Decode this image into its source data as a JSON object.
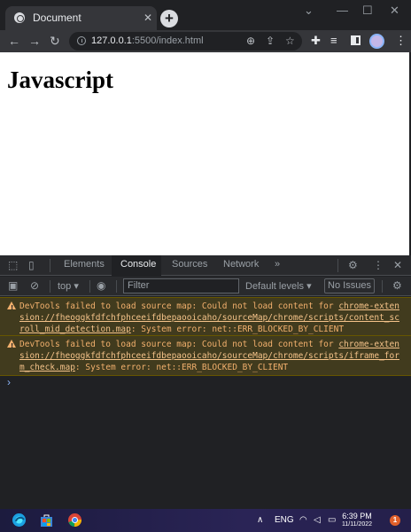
{
  "browser": {
    "tab_title": "Document",
    "tab_close": "✕",
    "new_tab": "+",
    "url_host": "127.0.0.1",
    "url_rest": ":5500/index.html",
    "icons": [
      "back-icon",
      "forward-icon",
      "reload-icon",
      "zoom-icon",
      "share-icon",
      "star-icon",
      "extensions-icon",
      "media-icon",
      "side-panel-icon",
      "profile-avatar",
      "menu-icon"
    ]
  },
  "page": {
    "heading": "Javascript"
  },
  "devtools": {
    "tabs": [
      "Elements",
      "Console",
      "Sources",
      "Network"
    ],
    "active_tab": "Console",
    "more_tabs": "»",
    "context": "top",
    "filter_placeholder": "Filter",
    "log_levels": "Default levels",
    "issues": "No Issues",
    "messages": [
      {
        "prefix": "DevTools failed to load source map: Could not load content for ",
        "link": "chrome-extension://fheoggkfdfchfphceeifdbepaooicaho/sourceMap/chrome/scripts/content_scroll_mid_detection.map",
        "suffix": ": System error: net::ERR_BLOCKED_BY_CLIENT"
      },
      {
        "prefix": "DevTools failed to load source map: Could not load content for ",
        "link": "chrome-extension://fheoggkfdfchfphceeifdbepaooicaho/sourceMap/chrome/scripts/iframe_form_check.map",
        "suffix": ": System error: net::ERR_BLOCKED_BY_CLIENT"
      }
    ],
    "prompt": "›",
    "warning_color": "#f2b06d"
  },
  "taskbar": {
    "language": "ENG",
    "time": "6:39 PM",
    "date": "11/11/2022",
    "notifications": "1"
  }
}
